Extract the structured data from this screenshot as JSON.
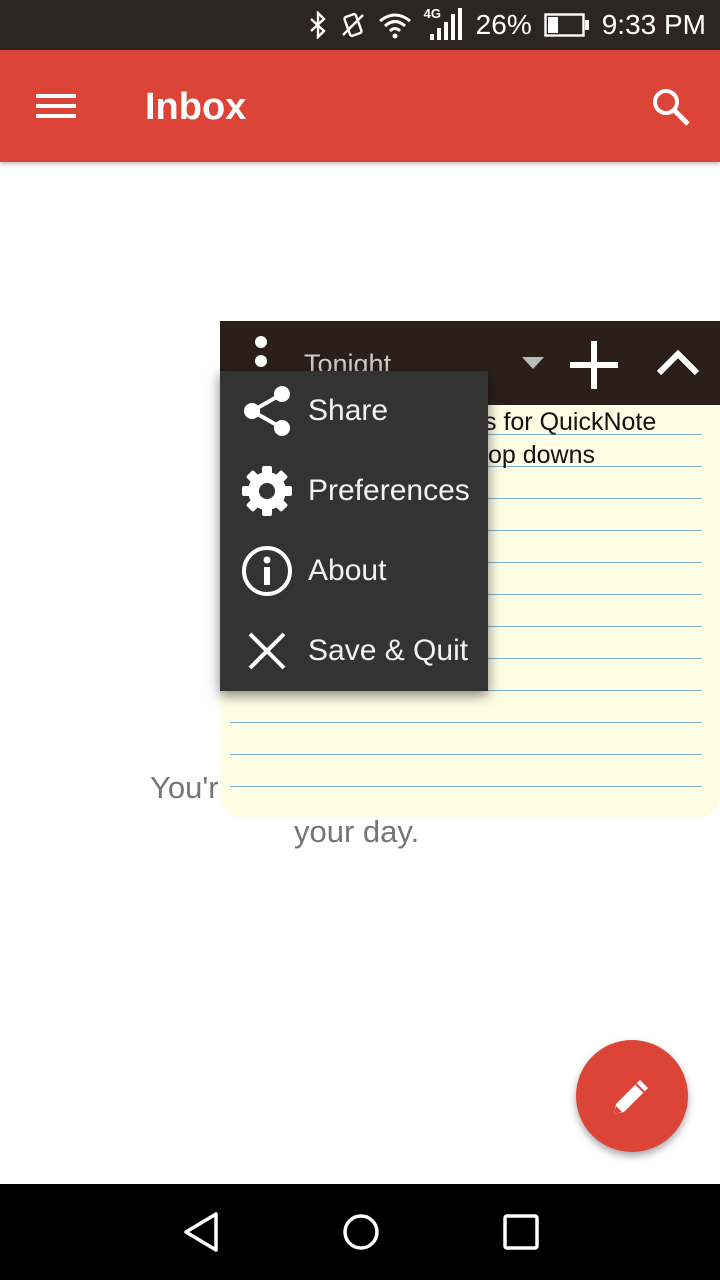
{
  "status_bar": {
    "network": "4G",
    "battery_percent": "26%",
    "time": "9:33 PM"
  },
  "app_bar": {
    "title": "Inbox",
    "menu_icon": "hamburger-menu-icon",
    "search_icon": "search-icon"
  },
  "empty_state": {
    "line1": "You'r",
    "line2": "your day."
  },
  "note_widget": {
    "title": "Tonight",
    "text_lines": [
      "s for QuickNote",
      "op downs"
    ],
    "icons": [
      "overflow-menu-icon",
      "dropdown-arrow-icon",
      "add-icon",
      "collapse-icon"
    ]
  },
  "popup_menu": {
    "items": [
      {
        "label": "Share",
        "icon": "share-icon"
      },
      {
        "label": "Preferences",
        "icon": "gear-icon"
      },
      {
        "label": "About",
        "icon": "info-icon"
      },
      {
        "label": "Save & Quit",
        "icon": "close-icon"
      }
    ]
  },
  "fab": {
    "icon": "pencil-icon"
  },
  "nav_bar": {
    "icons": [
      "back-icon",
      "home-icon",
      "recents-icon"
    ]
  },
  "colors": {
    "app_bar": "#db4437",
    "status_bar": "#2d2523",
    "note_header": "#2c1f19",
    "note_paper": "#fffde3",
    "popup": "#333333"
  }
}
